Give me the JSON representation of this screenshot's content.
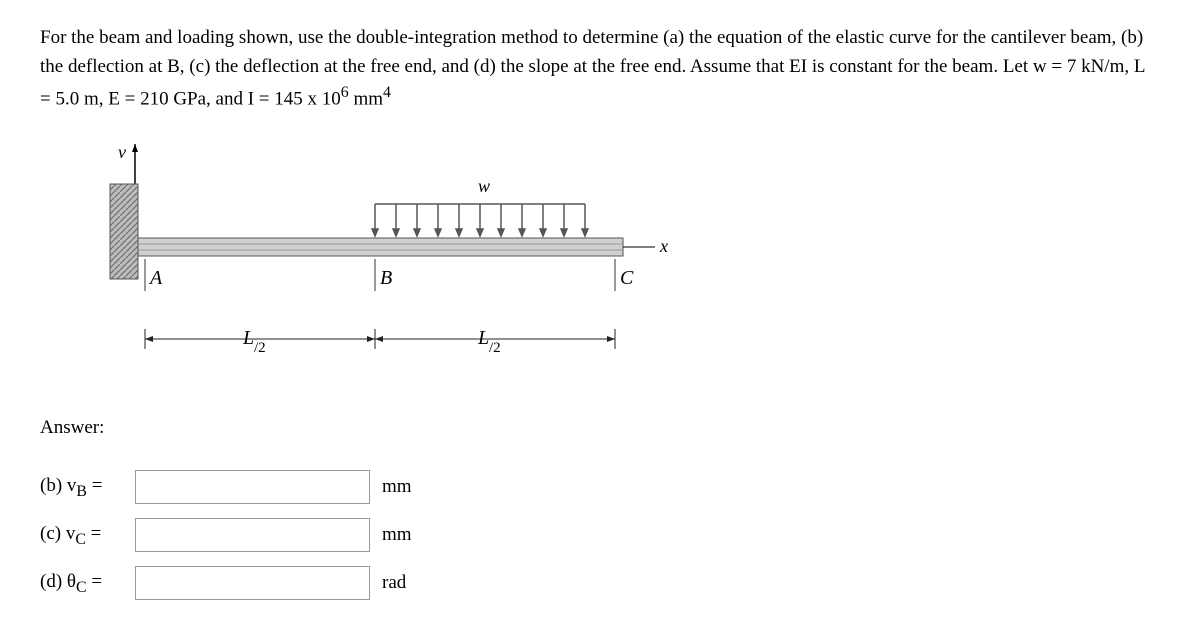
{
  "problem": {
    "text_before_sup": "For the beam and loading shown, use the double-integration method to determine (a) the equation of the elastic curve for the cantilever beam, (b) the deflection at B, (c) the deflection at the free end, and (d) the slope at the free end. Assume that EI is constant for the beam. Let w = 7 kN/m, L = 5.0 m, E = 210 GPa, and I = 145 x 10",
    "sup1": "6",
    "between_sups": " mm",
    "sup2": "4"
  },
  "figure": {
    "labels": {
      "v": "v",
      "w": "w",
      "x": "x",
      "A": "A",
      "B": "B",
      "C": "C",
      "L_half_left": "L/2",
      "L_half_right": "L/2"
    }
  },
  "answer_header": "Answer:",
  "answers": {
    "b": {
      "label": "(b) v",
      "sub": "B",
      "eq": " =",
      "unit": "mm"
    },
    "c": {
      "label": "(c) v",
      "sub": "C",
      "eq": " =",
      "unit": "mm"
    },
    "d": {
      "label": "(d) θ",
      "sub": "C",
      "eq": " =",
      "unit": "rad"
    }
  }
}
